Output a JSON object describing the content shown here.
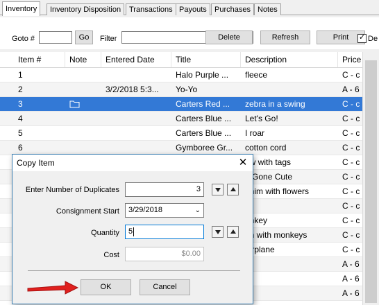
{
  "tabs": [
    "Inventory",
    "Inventory Disposition",
    "Transactions",
    "Payouts",
    "Purchases",
    "Notes"
  ],
  "toolbar": {
    "goto_label": "Goto #",
    "go_button": "Go",
    "filter_label": "Filter",
    "delete_button": "Delete",
    "refresh_button": "Refresh",
    "print_button": "Print",
    "checkbox_label": "De"
  },
  "grid": {
    "columns": [
      "Item #",
      "Note",
      "Entered Date",
      "Title",
      "Description",
      "Price Co"
    ],
    "rows": [
      {
        "item": "1",
        "note": "",
        "date": "",
        "title": "Halo Purple ...",
        "desc": "fleece",
        "price": "C - c"
      },
      {
        "item": "2",
        "note": "",
        "date": "3/2/2018 5:3...",
        "title": "Yo-Yo",
        "desc": "",
        "price": "A - 6"
      },
      {
        "item": "3",
        "note": "folder",
        "date": "",
        "title": "Carters Red ...",
        "desc": "zebra in a swing",
        "price": "C - c"
      },
      {
        "item": "4",
        "note": "",
        "date": "",
        "title": "Carters Blue ...",
        "desc": "Let's Go!",
        "price": "C - c"
      },
      {
        "item": "5",
        "note": "",
        "date": "",
        "title": "Carters Blue ...",
        "desc": "I roar",
        "price": "C - c"
      },
      {
        "item": "6",
        "note": "",
        "date": "",
        "title": "Gymboree Gr...",
        "desc": "cotton cord",
        "price": "C - c"
      },
      {
        "item": "",
        "note": "",
        "date": "",
        "title": "",
        "desc": "ew with tags",
        "price": "C - c"
      },
      {
        "item": "",
        "note": "",
        "date": "",
        "title": "",
        "desc": "g Gone Cute",
        "price": "C - c"
      },
      {
        "item": "",
        "note": "",
        "date": "",
        "title": "",
        "desc": "enim with flowers",
        "price": "C - c"
      },
      {
        "item": "",
        "note": "",
        "date": "",
        "title": "",
        "desc": "",
        "price": "C - c"
      },
      {
        "item": "",
        "note": "",
        "date": "",
        "title": "",
        "desc": "onkey",
        "price": "C - c"
      },
      {
        "item": "",
        "note": "",
        "date": "",
        "title": "",
        "desc": "en with monkeys",
        "price": "C - c"
      },
      {
        "item": "",
        "note": "",
        "date": "",
        "title": "",
        "desc": "airplane",
        "price": "C - c"
      },
      {
        "item": "",
        "note": "",
        "date": "",
        "title": "",
        "desc": "",
        "price": "A - 6"
      },
      {
        "item": "",
        "note": "",
        "date": "",
        "title": "",
        "desc": "",
        "price": "A - 6"
      },
      {
        "item": "",
        "note": "",
        "date": "",
        "title": "",
        "desc": "",
        "price": "A - 6"
      }
    ],
    "selected_row": 2
  },
  "dialog": {
    "title": "Copy Item",
    "duplicates_label": "Enter Number of Duplicates",
    "duplicates_value": "3",
    "consignment_label": "Consignment Start",
    "consignment_value": "3/29/2018",
    "quantity_label": "Quantity",
    "quantity_value": "5",
    "cost_label": "Cost",
    "cost_value": "$0.00",
    "ok_button": "OK",
    "cancel_button": "Cancel"
  },
  "colors": {
    "selection": "#3379d6",
    "arrow": "#e0201e",
    "dialog_border": "#3c7fb1"
  }
}
